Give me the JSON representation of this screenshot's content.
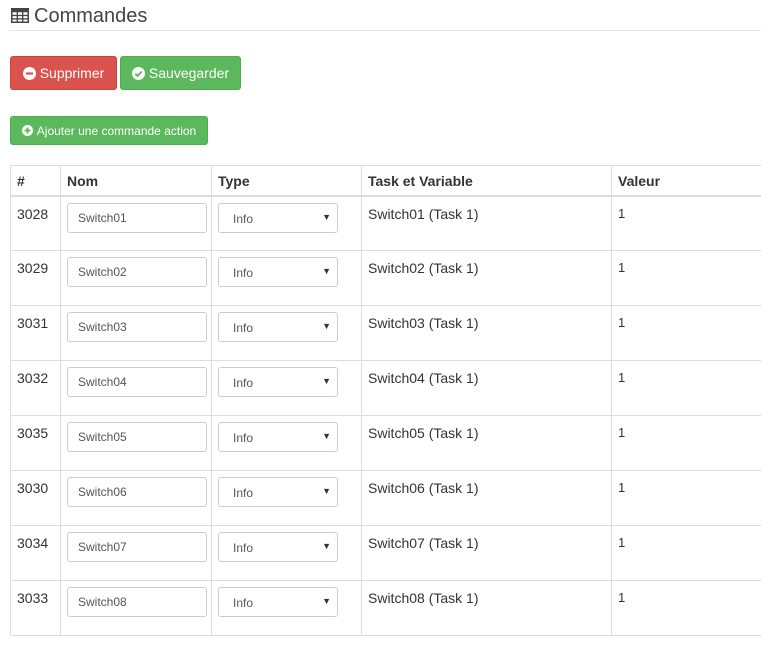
{
  "page": {
    "title": "Commandes"
  },
  "buttons": {
    "delete": "Supprimer",
    "save": "Sauvegarder",
    "add_action": "Ajouter une commande action"
  },
  "colors": {
    "danger": "#d9534f",
    "success": "#5cb85c"
  },
  "icons": {
    "title": "table-icon",
    "delete": "minus-circle-icon",
    "save": "check-circle-icon",
    "add": "plus-circle-icon",
    "select": "caret-down-icon"
  },
  "table": {
    "headers": {
      "id": "#",
      "name": "Nom",
      "type": "Type",
      "task": "Task et Variable",
      "value": "Valeur"
    },
    "rows": [
      {
        "id": "3028",
        "name": "Switch01",
        "type": "Info",
        "task": "Switch01 (Task 1)",
        "value": "1"
      },
      {
        "id": "3029",
        "name": "Switch02",
        "type": "Info",
        "task": "Switch02 (Task 1)",
        "value": "1"
      },
      {
        "id": "3031",
        "name": "Switch03",
        "type": "Info",
        "task": "Switch03 (Task 1)",
        "value": "1"
      },
      {
        "id": "3032",
        "name": "Switch04",
        "type": "Info",
        "task": "Switch04 (Task 1)",
        "value": "1"
      },
      {
        "id": "3035",
        "name": "Switch05",
        "type": "Info",
        "task": "Switch05 (Task 1)",
        "value": "1"
      },
      {
        "id": "3030",
        "name": "Switch06",
        "type": "Info",
        "task": "Switch06 (Task 1)",
        "value": "1"
      },
      {
        "id": "3034",
        "name": "Switch07",
        "type": "Info",
        "task": "Switch07 (Task 1)",
        "value": "1"
      },
      {
        "id": "3033",
        "name": "Switch08",
        "type": "Info",
        "task": "Switch08 (Task 1)",
        "value": "1"
      }
    ]
  }
}
